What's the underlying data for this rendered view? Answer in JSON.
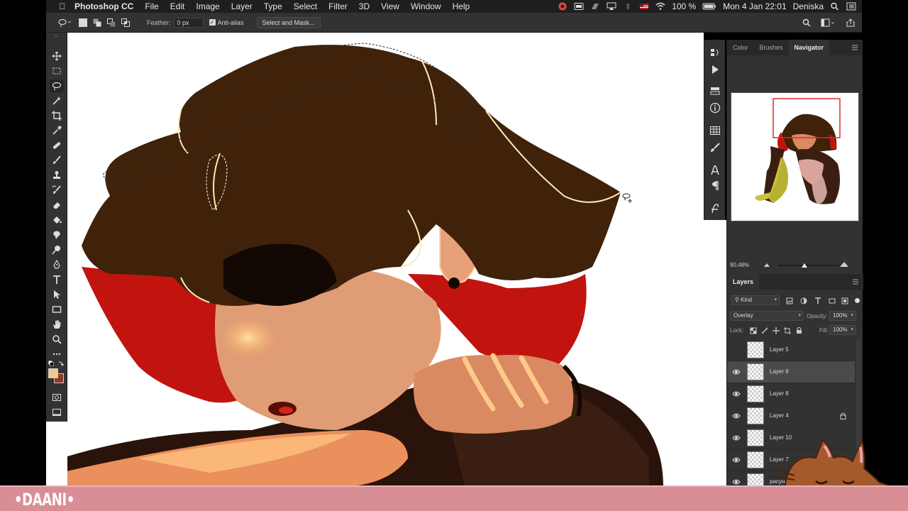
{
  "menubar": {
    "app_name": "Photoshop CC",
    "menus": [
      "File",
      "Edit",
      "Image",
      "Layer",
      "Type",
      "Select",
      "Filter",
      "3D",
      "View",
      "Window",
      "Help"
    ],
    "battery": "100 %",
    "datetime": "Mon 4 Jan  22:01",
    "user": "Deniska"
  },
  "options_bar": {
    "feather_label": "Feather:",
    "feather_value": "0 px",
    "anti_alias_label": "Anti-alias",
    "anti_alias_checked": true,
    "select_mask_label": "Select and Mask..."
  },
  "toolbar": {
    "tools": [
      "move-icon",
      "marquee-icon",
      "lasso-icon",
      "magic-wand-icon",
      "crop-icon",
      "eyedropper-icon",
      "healing-icon",
      "brush-icon",
      "stamp-icon",
      "history-brush-icon",
      "eraser-icon",
      "bucket-icon",
      "smudge-icon",
      "dodge-icon",
      "pen-icon",
      "type-icon",
      "path-select-icon",
      "rectangle-icon",
      "hand-icon",
      "zoom-icon",
      "more-icon"
    ],
    "active_tool": "lasso-icon",
    "foreground_color": "#f5c98a",
    "background_color": "#8b3a2a"
  },
  "panels": {
    "top_tabs": [
      "Color",
      "Brushes",
      "Navigator"
    ],
    "active_top_tab": "Navigator",
    "navigator_zoom": "90,48%",
    "layers_tab": "Layers",
    "kind_filter": "Kind",
    "blend_mode": "Overlay",
    "opacity_label": "Opacity:",
    "opacity_value": "100%",
    "lock_label": "Lock:",
    "fill_label": "Fill:",
    "fill_value": "100%",
    "layers": [
      {
        "name": "Layer 5",
        "visible": false,
        "selected": false,
        "locked": false
      },
      {
        "name": "Layer 9",
        "visible": true,
        "selected": true,
        "locked": false
      },
      {
        "name": "Layer 8",
        "visible": true,
        "selected": false,
        "locked": false
      },
      {
        "name": "Layer 4",
        "visible": true,
        "selected": false,
        "locked": true
      },
      {
        "name": "Layer 10",
        "visible": true,
        "selected": false,
        "locked": false
      },
      {
        "name": "Layer 7",
        "visible": true,
        "selected": false,
        "locked": false
      },
      {
        "name": "рисунок",
        "visible": true,
        "selected": false,
        "locked": false
      }
    ]
  },
  "banner": {
    "brand": "•DAANI•"
  },
  "colors": {
    "hair": "#3f2209",
    "hair_red": "#c1140f",
    "skin": "#e09c75",
    "skin_light": "#ffc98a",
    "banner": "#d98e96"
  }
}
